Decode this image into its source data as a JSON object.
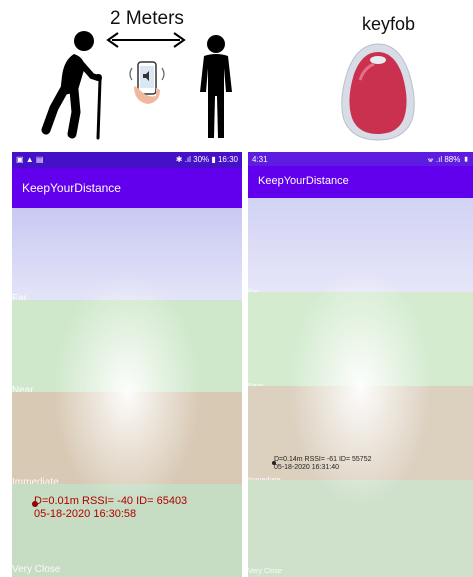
{
  "illustration": {
    "distance_label": "2 Meters",
    "device_label": "keyfob",
    "icons": [
      "elderly-person-with-cane-icon",
      "double-arrow-icon",
      "phone-vibrating-icon",
      "person-standing-icon",
      "keyfob-icon"
    ]
  },
  "left_screen": {
    "status_right": "✱ .ıl 30% ▮ 16:30",
    "app_title": "KeepYourDistance",
    "zones": [
      {
        "label": "Far",
        "color": "#d8d8f4"
      },
      {
        "label": "Near",
        "color": "#d6ecd2"
      },
      {
        "label": "Immediate",
        "color": "#e2d8c8"
      },
      {
        "label": "Very Close",
        "color": "#cfe0cc"
      }
    ],
    "reading_line1": "D=0.01m RSSI= -40 ID= 65403",
    "reading_line2": "05-18-2020 16:30:58"
  },
  "right_screen": {
    "status_left": "4:31",
    "status_right": "⩖ .ıl 88% ▮",
    "app_title": "KeepYourDistance",
    "zones": [
      {
        "label": "Far",
        "color": "#d8d8f4"
      },
      {
        "label": "Near",
        "color": "#d6ecd2"
      },
      {
        "label": "Immediate",
        "color": "#e2d8c8"
      },
      {
        "label": "Very Close",
        "color": "#cfe0cc"
      }
    ],
    "reading_line1": "D=0.14m RSSI= -61 ID= 55752",
    "reading_line2": "05-18-2020 16:31:40"
  },
  "colors": {
    "status_bar": "#4510c8",
    "app_bar": "#6200ee",
    "reading_text": "#b00000"
  }
}
